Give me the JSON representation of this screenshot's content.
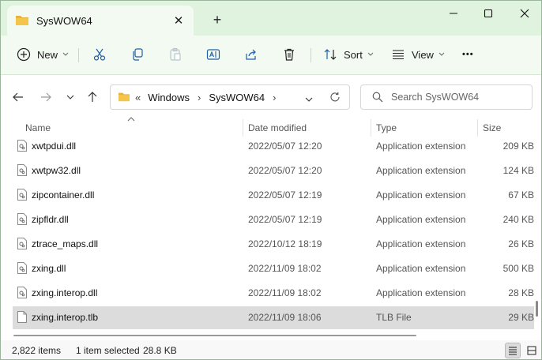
{
  "tab": {
    "title": "SysWOW64",
    "close_glyph": "✕",
    "new_tab_glyph": "+"
  },
  "toolbar": {
    "new_label": "New",
    "sort_label": "Sort",
    "view_label": "View",
    "more_glyph": "•••"
  },
  "address": {
    "overflow_glyph": "«",
    "segments": [
      "Windows",
      "SysWOW64"
    ],
    "separator": "›"
  },
  "search": {
    "placeholder": "Search SysWOW64"
  },
  "columns": {
    "name": "Name",
    "date": "Date modified",
    "type": "Type",
    "size": "Size"
  },
  "files": [
    {
      "name": "xwtpdui.dll",
      "date": "2022/05/07 12:20",
      "type": "Application extension",
      "size": "209 KB"
    },
    {
      "name": "xwtpw32.dll",
      "date": "2022/05/07 12:20",
      "type": "Application extension",
      "size": "124 KB"
    },
    {
      "name": "zipcontainer.dll",
      "date": "2022/05/07 12:19",
      "type": "Application extension",
      "size": "67 KB"
    },
    {
      "name": "zipfldr.dll",
      "date": "2022/05/07 12:19",
      "type": "Application extension",
      "size": "240 KB"
    },
    {
      "name": "ztrace_maps.dll",
      "date": "2022/10/12 18:19",
      "type": "Application extension",
      "size": "26 KB"
    },
    {
      "name": "zxing.dll",
      "date": "2022/11/09 18:02",
      "type": "Application extension",
      "size": "500 KB"
    },
    {
      "name": "zxing.interop.dll",
      "date": "2022/11/09 18:02",
      "type": "Application extension",
      "size": "28 KB"
    },
    {
      "name": "zxing.interop.tlb",
      "date": "2022/11/09 18:06",
      "type": "TLB File",
      "size": "29 KB",
      "selected": true
    }
  ],
  "status": {
    "item_count": "2,822 items",
    "selection": "1 item selected",
    "selection_size": "28.8 KB"
  },
  "colors": {
    "title_bar": "#dff3de",
    "toolbar": "#f3faf2",
    "folder_yellow": "#f3c64b",
    "selected_row": "#dcdcdc"
  }
}
